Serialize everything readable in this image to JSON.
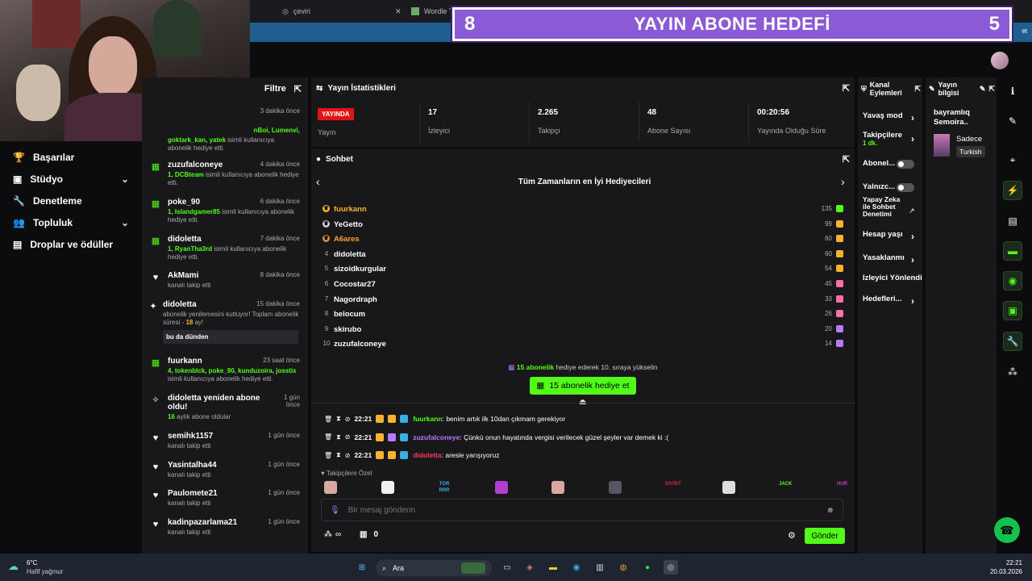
{
  "browser": {
    "tabs": [
      {
        "label": "çeviri"
      },
      {
        "label": "Wordle Tü"
      }
    ],
    "right_snippet": "et"
  },
  "goal": {
    "left": "8",
    "title": "YAYIN ABONE HEDEFİ",
    "right": "5"
  },
  "nav": {
    "items": [
      {
        "label": "Başarılar",
        "icon": "trophy-icon"
      },
      {
        "label": "Stüdyo",
        "icon": "camera-icon"
      },
      {
        "label": "Denetleme",
        "icon": "wrench-icon"
      },
      {
        "label": "Topluluk",
        "icon": "people-icon"
      },
      {
        "label": "Droplar ve ödüller",
        "icon": "gift-drop-icon"
      }
    ]
  },
  "feed": {
    "header": "Filtre",
    "partial_top": {
      "time": "3 dakika önce",
      "names": "nBoi, Lumenvi,",
      "line2": "goktark_kan, yatek",
      "desc": "isimli kullanıcıya abonelik hediye etti."
    },
    "items": [
      {
        "name": "zuzufalconeye",
        "time": "4 dakika önce",
        "highlight": "1, DCBteam",
        "desc": " isimli kullanıcıya abonelik hediye etti."
      },
      {
        "name": "poke_90",
        "time": "6 dakika önce",
        "highlight": "1, Islandgamer85",
        "desc": " isimli kullanıcıya abonelik hediye etti."
      },
      {
        "name": "didoletta",
        "time": "7 dakika önce",
        "highlight": "1, RyanTha3rd",
        "desc": " isimli kullanıcıya abonelik hediye etti."
      },
      {
        "name": "AkMami",
        "time": "8 dakika önce",
        "desc": "kanalı takip etti"
      },
      {
        "name": "didoletta",
        "time": "15 dakika önce",
        "desc": "abonelik yenilemesini kutluyor! Toplam abonelik süresi - ",
        "months": "18",
        "ay": " ay!",
        "quote": "bu da dünden"
      },
      {
        "name": "fuurkann",
        "time": "23 saat önce",
        "highlight": "4, tokenblck, poke_90, kunduzoira, josstix",
        "desc": " isimli kullanıcıya abonelik hediye etti."
      },
      {
        "name": "didoletta yeniden abone oldu!",
        "time": "1 gün önce",
        "months": "16",
        "desc": " aylık abone oldular"
      },
      {
        "name": "semihk1157",
        "time": "1 gün önce",
        "desc": "kanalı takip etti"
      },
      {
        "name": "Yasintalha44",
        "time": "1 gün önce",
        "desc": "kanalı takip etti"
      },
      {
        "name": "Paulomete21",
        "time": "1 gün önce",
        "desc": "kanalı takip etti"
      },
      {
        "name": "kadinpazarlama21",
        "time": "1 gün önce",
        "desc": "kanalı takip etti"
      }
    ]
  },
  "stats": {
    "title": "Yayın İstatistikleri",
    "live_badge": "YAYINDA",
    "live_label": "Yayın",
    "items": [
      {
        "value": "17",
        "label": "İzleyici"
      },
      {
        "value": "2.265",
        "label": "Takipçi"
      },
      {
        "value": "48",
        "label": "Abone Sayısı"
      },
      {
        "value": "00:20:56",
        "label": "Yayında Olduğu Süre"
      }
    ]
  },
  "chat": {
    "title": "Sohbet",
    "carousel_title": "Tüm Zamanların en İyi Hediyecileri",
    "gifters": [
      {
        "rank": "",
        "name": "fuurkann",
        "count": "135",
        "color": "#f7b32b",
        "gift": "#53fc18"
      },
      {
        "rank": "",
        "name": "YeGetto",
        "count": "99",
        "color": "#ffffff",
        "gift": "#f7b32b"
      },
      {
        "rank": "",
        "name": "A6ares",
        "count": "60",
        "color": "#ff9f2e",
        "gift": "#f7b32b"
      },
      {
        "rank": "4",
        "name": "didoletta",
        "count": "60",
        "color": "#ffffff",
        "gift": "#f7b32b"
      },
      {
        "rank": "5",
        "name": "sizoidkurgular",
        "count": "54",
        "color": "#ffffff",
        "gift": "#f7b32b"
      },
      {
        "rank": "6",
        "name": "Cocostar27",
        "count": "45",
        "color": "#ffffff",
        "gift": "#ff6fa8"
      },
      {
        "rank": "7",
        "name": "Nagordraph",
        "count": "33",
        "color": "#ffffff",
        "gift": "#ff6fa8"
      },
      {
        "rank": "8",
        "name": "belocum",
        "count": "26",
        "color": "#ffffff",
        "gift": "#ff6fa8"
      },
      {
        "rank": "9",
        "name": "skirubo",
        "count": "20",
        "color": "#ffffff",
        "gift": "#b57aff"
      },
      {
        "rank": "10",
        "name": "zuzufalconeye",
        "count": "14",
        "color": "#ffffff",
        "gift": "#b57aff"
      }
    ],
    "promo_count": "15 abonelik",
    "promo_text": " hediye ederek 10. sıraya yükselin",
    "gift_button": "15 abonelik hediye et",
    "messages": [
      {
        "time": "22:21",
        "user": "fuurkann",
        "user_color": "#53fc18",
        "text": ": benim artık ilk 10dan çıkmam gerekiyor"
      },
      {
        "time": "22:21",
        "user": "zuzufalconeye",
        "user_color": "#b57aff",
        "text": ": Çünkü onun hayatında vergisi verilecek güzel şeyler var demek ki :("
      },
      {
        "time": "22:21",
        "user": "didoletta",
        "user_color": "#ff3b5c",
        "text": ": aresle yarışıyoruz"
      }
    ],
    "emote_label": "Takipçilere Özel",
    "emotes": [
      "",
      "",
      "TOR RRR",
      "",
      "",
      "",
      "DIVIDT",
      "",
      "JACK",
      "HUR"
    ],
    "input_placeholder": "Bir mesaj gönderin",
    "points": "0",
    "send": "Gönder"
  },
  "actions": {
    "title": "Kanal Eylemleri",
    "items": [
      {
        "label": "Yavaş mod"
      },
      {
        "label": "Takipçilere",
        "sub": "1 dk."
      },
      {
        "label": "Abonel..."
      },
      {
        "label": "Yalnızc..."
      },
      {
        "label": "Yapay Zeka ile Sohbet Denetimi"
      },
      {
        "label": "Hesap yaşı"
      },
      {
        "label": "Yasaklanmı"
      },
      {
        "label": "İzleyici Yönlendi"
      },
      {
        "label": "Hedefleri..."
      }
    ]
  },
  "info": {
    "title": "Yayın bilgisi",
    "stream_title": "bayramlıq Semoira..",
    "category": "Sadece",
    "language": "Turkish"
  },
  "taskbar": {
    "temp": "6°C",
    "weather": "Hafif yağmur",
    "search": "Ara",
    "time": "22:21",
    "date": "20.03.2026"
  }
}
